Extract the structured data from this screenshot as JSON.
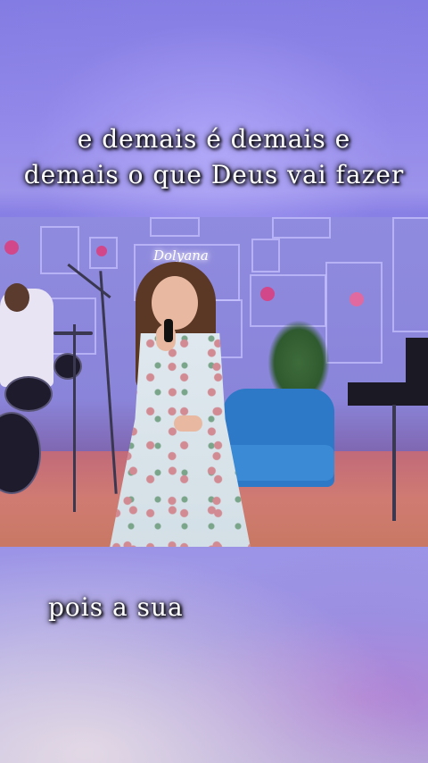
{
  "captions": {
    "top_line1": "e demais é demais e",
    "top_line2": "demais o que Deus vai fazer",
    "bottom": "pois a sua"
  },
  "video": {
    "neon_sign": "Dolyana"
  },
  "colors": {
    "background": "#9a90ee",
    "caption_text": "#ffffff",
    "sofa": "#2e78c8",
    "floor": "#c87864"
  }
}
